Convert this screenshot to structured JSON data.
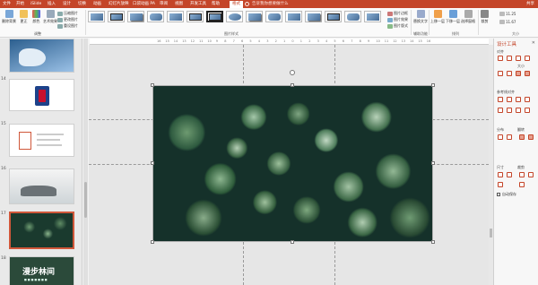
{
  "tabs": [
    "文件",
    "开始",
    "iSlide",
    "插入",
    "设计",
    "切换",
    "动画",
    "幻灯片放映",
    "口袋动画 PA",
    "审阅",
    "视图",
    "开发工具",
    "帮助",
    "格式"
  ],
  "active_tab": "格式",
  "tell_me": "告诉我你想要做什么",
  "share": "共享",
  "ribbon": {
    "adjust_items": [
      "删除背景",
      "更正",
      "颜色",
      "艺术效果"
    ],
    "compress_items": [
      "压缩图片",
      "更改图片",
      "重设图片"
    ],
    "adjust_label": "调整",
    "styles_label": "图片样式",
    "picture_border": "图片边框",
    "picture_effects": "图片效果",
    "picture_layout": "图片版式",
    "alt_text": "替换文字",
    "accessibility_label": "辅助功能",
    "arrange_items": [
      "上移一层",
      "下移一层",
      "选择窗格"
    ],
    "arrange_label": "排列",
    "crop": "裁剪",
    "size_label": "大小",
    "height": "11.25",
    "width": "11.67"
  },
  "ruler_ticks": [
    "16",
    "15",
    "14",
    "13",
    "12",
    "11",
    "10",
    "9",
    "8",
    "7",
    "6",
    "5",
    "4",
    "3",
    "2",
    "1",
    "0",
    "1",
    "2",
    "3",
    "4",
    "5",
    "6",
    "7",
    "8",
    "9",
    "10",
    "11",
    "12",
    "13",
    "14",
    "15",
    "16"
  ],
  "slides": [
    {
      "number": "",
      "kind": "map"
    },
    {
      "number": "14",
      "kind": "nba"
    },
    {
      "number": "15",
      "kind": "doc"
    },
    {
      "number": "16",
      "kind": "photo"
    },
    {
      "number": "17",
      "kind": "forest",
      "selected": true
    },
    {
      "number": "18",
      "kind": "title",
      "title": "漫步林间",
      "subtitle": "■ ■ ■ ■ ■ ■ ■"
    }
  ],
  "pane": {
    "title": "设计工具",
    "sections": [
      "对齐",
      "大小",
      "参考线对齐",
      "分布",
      "翻转",
      "尺寸",
      "裁剪"
    ],
    "checkbox_label": "自动保存"
  }
}
